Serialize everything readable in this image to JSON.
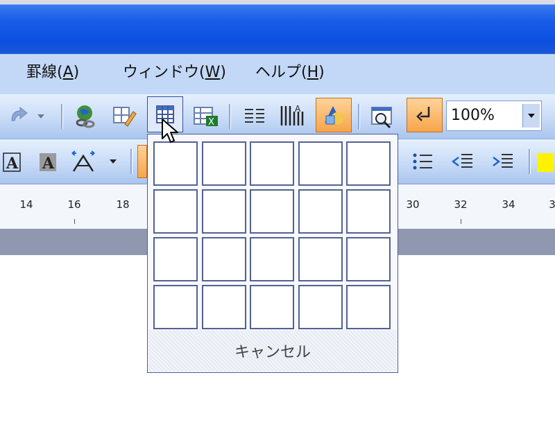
{
  "menu": {
    "items": [
      {
        "label": "罫線(A)"
      },
      {
        "label": "ウィンドウ(W)"
      },
      {
        "label": "ヘルプ(H)"
      }
    ]
  },
  "toolbar": {
    "zoom_value": "100%"
  },
  "ruler": {
    "labels": [
      "14",
      "16",
      "18",
      "30",
      "32",
      "34",
      "3"
    ]
  },
  "table_grid": {
    "rows": 4,
    "columns": 5,
    "cancel_label": "キャンセル"
  },
  "colors": {
    "titlebar": "#0b4fe0",
    "menubar": "#c2d8f6",
    "active_button": "#f6a54a",
    "grid_border": "#54618f"
  }
}
